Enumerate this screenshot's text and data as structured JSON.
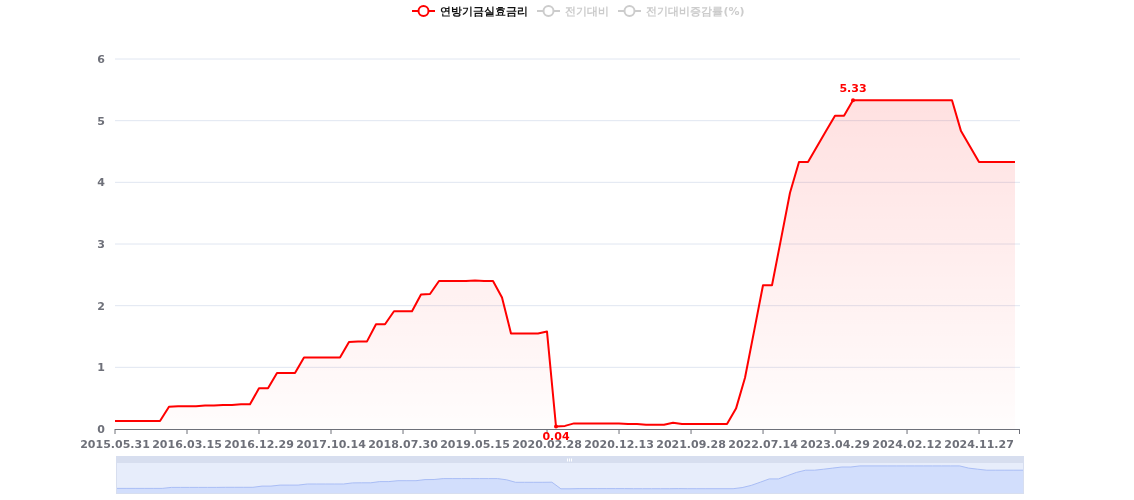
{
  "legend": [
    {
      "label": "전기대비",
      "on": false
    },
    {
      "label": "전기대비증감률(%)",
      "on": false
    }
  ],
  "chart": {
    "chart_data": {
      "type": "area",
      "ylim": [
        0,
        6
      ],
      "yticks": [
        0,
        1,
        2,
        3,
        4,
        5,
        6
      ],
      "categories": [
        "2015.05.31",
        null,
        null,
        null,
        null,
        null,
        null,
        null,
        "2016.03.15",
        null,
        null,
        null,
        null,
        null,
        null,
        null,
        "2016.12.29",
        null,
        null,
        null,
        null,
        null,
        null,
        null,
        "2017.10.14",
        null,
        null,
        null,
        null,
        null,
        null,
        null,
        "2018.07.30",
        null,
        null,
        null,
        null,
        null,
        null,
        null,
        "2019.05.15",
        null,
        null,
        null,
        null,
        null,
        null,
        null,
        "2020.02.28",
        null,
        null,
        null,
        null,
        null,
        null,
        null,
        "2020.12.13",
        null,
        null,
        null,
        null,
        null,
        null,
        null,
        "2021.09.28",
        null,
        null,
        null,
        null,
        null,
        null,
        null,
        "2022.07.14",
        null,
        null,
        null,
        null,
        null,
        null,
        null,
        "2023.04.29",
        null,
        null,
        null,
        null,
        null,
        null,
        null,
        "2024.02.12",
        null,
        null,
        null,
        null,
        null,
        null,
        null,
        "2024.11.27",
        null,
        null,
        null,
        null
      ],
      "series": [
        {
          "name": "연방기금실효금리",
          "color": "#ff0000",
          "values": [
            0.13,
            0.13,
            0.13,
            0.13,
            0.13,
            0.13,
            0.36,
            0.37,
            0.37,
            0.37,
            0.38,
            0.38,
            0.39,
            0.39,
            0.4,
            0.4,
            0.66,
            0.66,
            0.91,
            0.91,
            0.91,
            1.16,
            1.16,
            1.16,
            1.16,
            1.16,
            1.41,
            1.42,
            1.42,
            1.7,
            1.7,
            1.91,
            1.91,
            1.91,
            2.18,
            2.19,
            2.4,
            2.4,
            2.4,
            2.4,
            2.41,
            2.4,
            2.4,
            2.13,
            1.55,
            1.55,
            1.55,
            1.55,
            1.58,
            0.04,
            0.05,
            0.09,
            0.09,
            0.09,
            0.09,
            0.09,
            0.09,
            0.08,
            0.08,
            0.07,
            0.07,
            0.07,
            0.1,
            0.08,
            0.08,
            0.08,
            0.08,
            0.08,
            0.08,
            0.33,
            0.83,
            1.58,
            2.33,
            2.33,
            3.08,
            3.83,
            4.33,
            4.33,
            4.58,
            4.83,
            5.08,
            5.08,
            5.33,
            5.33,
            5.33,
            5.33,
            5.33,
            5.33,
            5.33,
            5.33,
            5.33,
            5.33,
            5.33,
            5.33,
            4.83,
            4.58,
            4.33,
            4.33,
            4.33,
            4.33,
            4.33
          ]
        }
      ],
      "grid": true,
      "annotations": [
        {
          "y": 5.33,
          "text": "5.33"
        },
        {
          "y": 0.04,
          "text": "0.04"
        }
      ]
    }
  },
  "data_zoom": {
    "level": 1
  }
}
